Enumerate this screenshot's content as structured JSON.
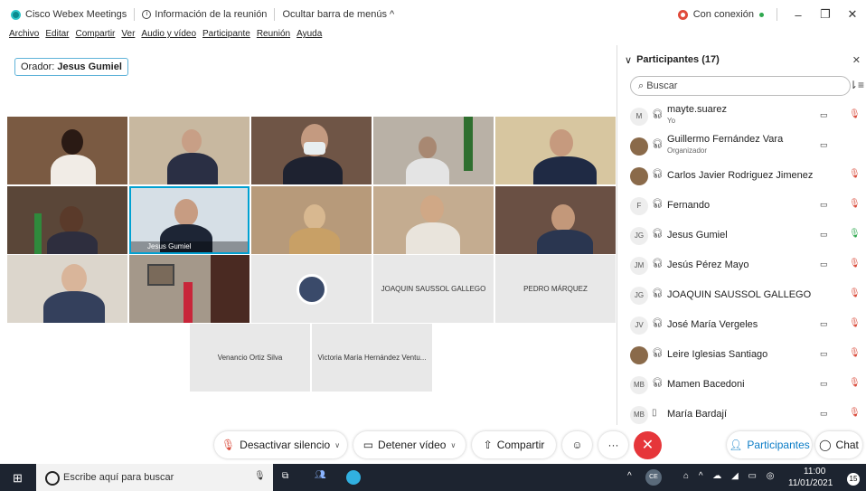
{
  "titlebar": {
    "app": "Cisco Webex Meetings",
    "info": "Información de la reunión",
    "hide_menu": "Ocultar barra de menús ^",
    "status": "Con conexión"
  },
  "menu": [
    "Archivo",
    "Editar",
    "Compartir",
    "Ver",
    "Audio y vídeo",
    "Participante",
    "Reunión",
    "Ayuda"
  ],
  "speaker": {
    "label": "Orador: ",
    "name": "Jesus Gumiel"
  },
  "tiles": {
    "active_name": "Jesus Gumiel",
    "t14": "JOAQUIN SAUSSOL GALLEGO",
    "t15": "PEDRO MÁRQUEZ",
    "t16": "Venancio Ortiz Silva",
    "t17": "Victoria María Hernández Ventu..."
  },
  "panel": {
    "title": "Participantes (17)",
    "search_placeholder": "Buscar",
    "participants": [
      {
        "initials": "M",
        "name": "mayte.suarez",
        "sub": "Yo"
      },
      {
        "initials": "",
        "name": "Guillermo Fernández Vara",
        "sub": "Organizador"
      },
      {
        "initials": "",
        "name": "Carlos Javier Rodriguez Jimenez",
        "sub": ""
      },
      {
        "initials": "F",
        "name": "Fernando",
        "sub": ""
      },
      {
        "initials": "JG",
        "name": "Jesus Gumiel",
        "sub": ""
      },
      {
        "initials": "JM",
        "name": "Jesús Pérez Mayo",
        "sub": ""
      },
      {
        "initials": "JG",
        "name": "JOAQUIN SAUSSOL GALLEGO",
        "sub": ""
      },
      {
        "initials": "JV",
        "name": "José María Vergeles",
        "sub": ""
      },
      {
        "initials": "",
        "name": "Leire Iglesias Santiago",
        "sub": ""
      },
      {
        "initials": "MB",
        "name": "Mamen Bacedoni",
        "sub": ""
      },
      {
        "initials": "MB",
        "name": "María Bardají",
        "sub": ""
      }
    ]
  },
  "controls": {
    "mute": "Desactivar silencio",
    "video": "Detener vídeo",
    "share": "Compartir",
    "participants": "Participantes",
    "chat": "Chat"
  },
  "taskbar": {
    "search": "Escribe aquí para buscar",
    "time": "11:00",
    "date": "11/01/2021",
    "badge": "15"
  }
}
